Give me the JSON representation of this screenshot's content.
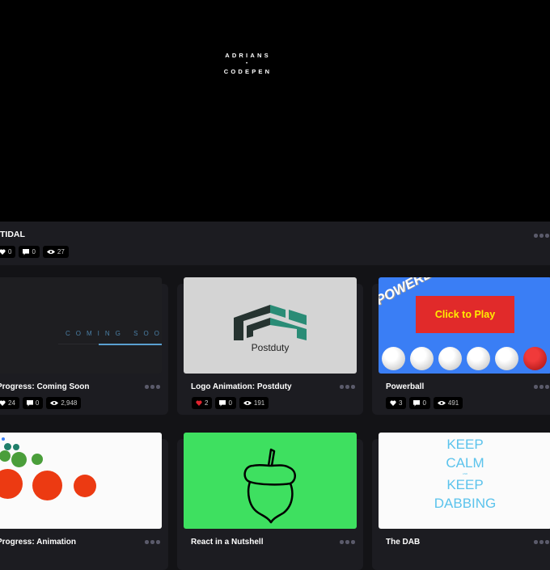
{
  "header": {
    "logo_line1": "ADRIANS",
    "logo_sep": "•",
    "logo_line2": "CODEPEN",
    "background": "#000000"
  },
  "featured": {
    "title": "TIDAL",
    "likes": "0",
    "comments": "0",
    "views": "27"
  },
  "icons": {
    "heart": "heart-icon",
    "comment": "comment-icon",
    "eye": "eye-icon",
    "more": "more-options-icon"
  },
  "pens": [
    {
      "title": "Progress: Coming Soon",
      "likes": "24",
      "liked": false,
      "comments": "0",
      "views": "2,948",
      "preview": {
        "text": "COMING SOON",
        "accent": "#5aa0d0",
        "bg": "#1e1e21"
      }
    },
    {
      "title": "Logo Animation: Postduty",
      "likes": "2",
      "liked": true,
      "comments": "0",
      "views": "191",
      "preview": {
        "text": "Postduty",
        "dark": "#263330",
        "accent": "#2a8c76",
        "bg": "#d4d4d4"
      }
    },
    {
      "title": "Powerball",
      "likes": "3",
      "liked": false,
      "comments": "0",
      "views": "491",
      "preview": {
        "banner": "POWERBALL",
        "button": "Click to Play",
        "bg": "#3a7ef5",
        "button_bg": "#e12a2a",
        "button_fg": "#ffee00"
      }
    },
    {
      "title": "Progress: Animation",
      "preview": {
        "bg": "#fbfbfb",
        "red": "#ec3a12",
        "green": "#4a9e3a",
        "teal": "#1f7f6a"
      }
    },
    {
      "title": "React in a Nutshell",
      "preview": {
        "bg": "#3ee060"
      }
    },
    {
      "title": "The DAB",
      "preview": {
        "line1": "KEEP",
        "line2": "CALM",
        "and": "AND",
        "line3": "KEEP",
        "line4": "DABBING",
        "color": "#5bc3ec",
        "bg": "#fbfbfb"
      }
    }
  ],
  "colors": {
    "page_bg": "#131316",
    "card_bg": "#1c1c21",
    "like_active": "#e0232e"
  }
}
